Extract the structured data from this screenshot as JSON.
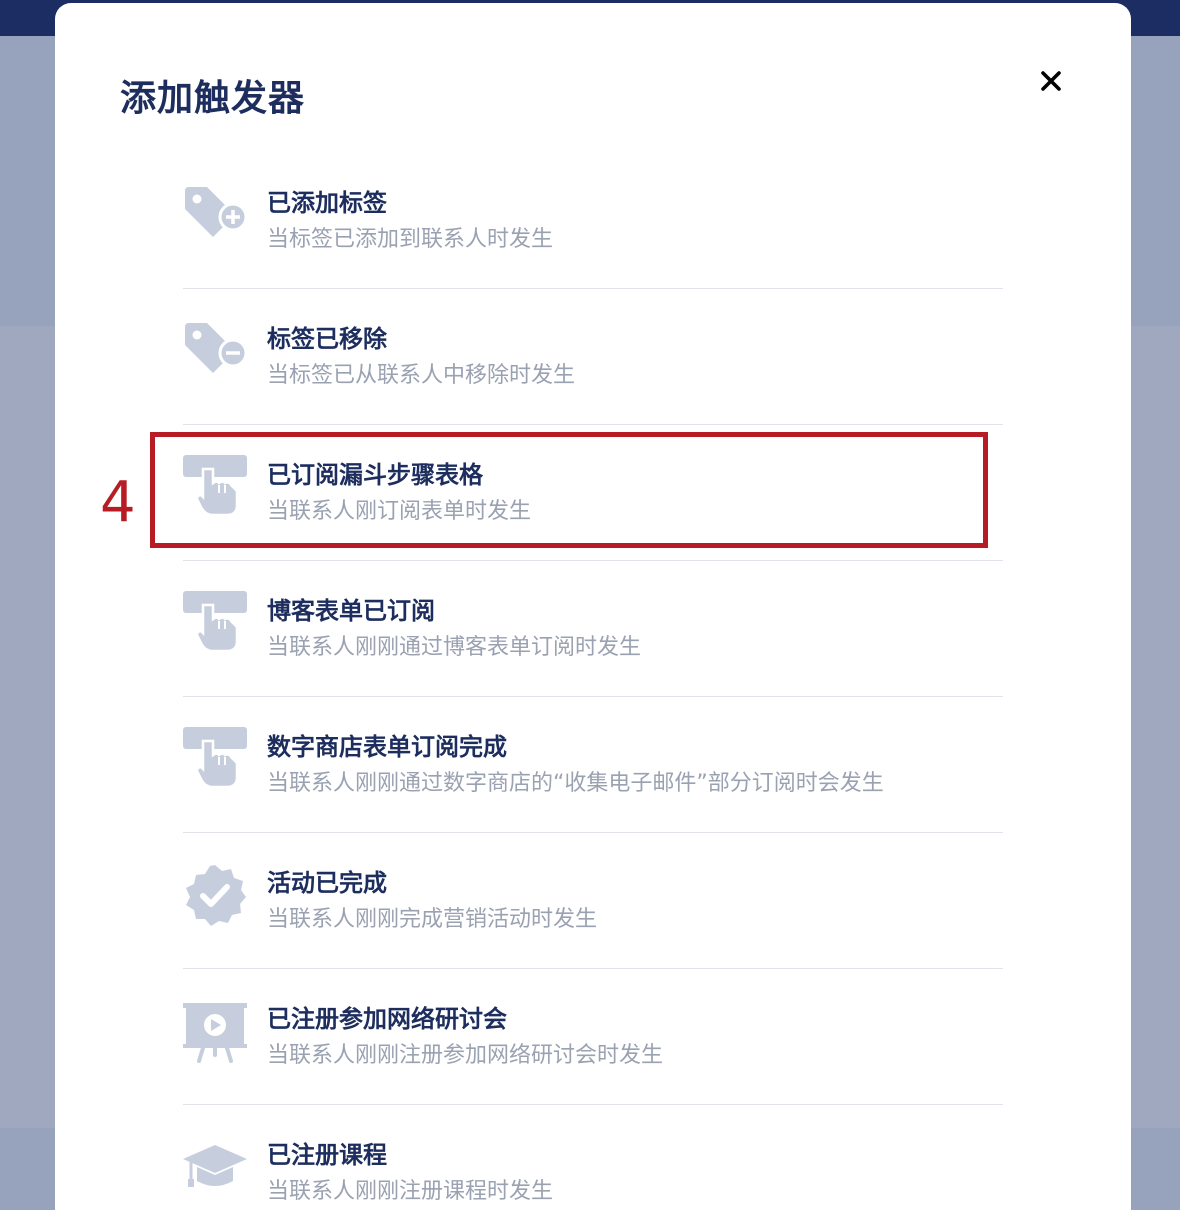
{
  "dialog": {
    "title": "添加触发器",
    "close_icon": "close-icon"
  },
  "triggers": [
    {
      "name": "已添加标签",
      "desc": "当标签已添加到联系人时发生",
      "icon": "tag-add-icon"
    },
    {
      "name": "标签已移除",
      "desc": "当标签已从联系人中移除时发生",
      "icon": "tag-remove-icon"
    },
    {
      "name": "已订阅漏斗步骤表格",
      "desc": "当联系人刚订阅表单时发生",
      "icon": "form-click-icon"
    },
    {
      "name": "博客表单已订阅",
      "desc": "当联系人刚刚通过博客表单订阅时发生",
      "icon": "form-click-icon"
    },
    {
      "name": "数字商店表单订阅完成",
      "desc": "当联系人刚刚通过数字商店的“收集电子邮件”部分订阅时会发生",
      "icon": "form-click-icon"
    },
    {
      "name": "活动已完成",
      "desc": "当联系人刚刚完成营销活动时发生",
      "icon": "badge-check-icon"
    },
    {
      "name": "已注册参加网络研讨会",
      "desc": "当联系人刚刚注册参加网络研讨会时发生",
      "icon": "webinar-icon"
    },
    {
      "name": "已注册课程",
      "desc": "当联系人刚刚注册课程时发生",
      "icon": "graduation-cap-icon"
    }
  ],
  "annotation": {
    "step_number": "4",
    "color": "#b71c24"
  },
  "colors": {
    "title": "#1d2e5e",
    "description": "#9aa1b1",
    "icon": "#c6cedd",
    "backdrop_bar": "#1b2d63"
  }
}
